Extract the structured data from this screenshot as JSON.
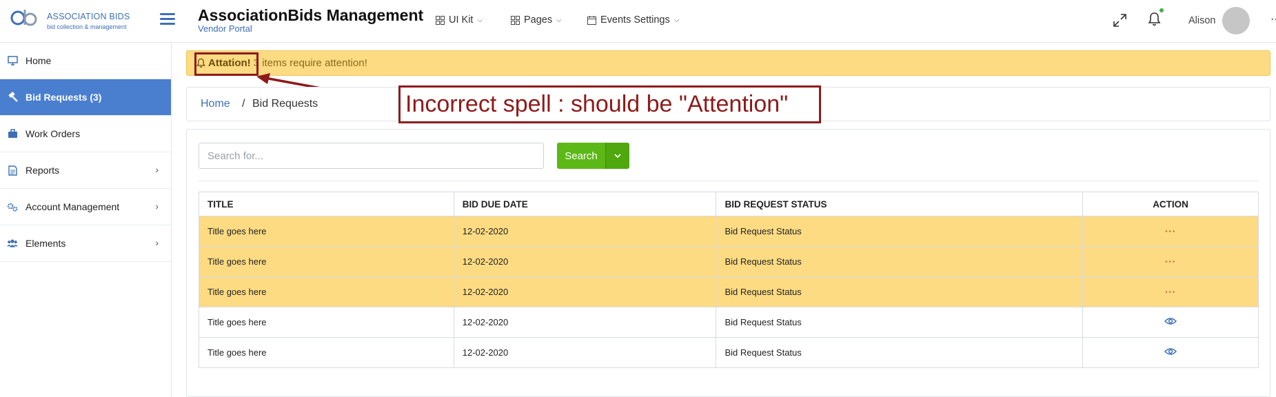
{
  "header": {
    "logo": {
      "name": "ASSOCIATION BIDS",
      "tagline": "bid collection & management"
    },
    "app_title": "AssociationBids Management",
    "app_subtitle": "Vendor Portal",
    "nav": [
      {
        "label": "UI Kit",
        "icon": "grid-icon"
      },
      {
        "label": "Pages",
        "icon": "grid-icon"
      },
      {
        "label": "Events Settings",
        "icon": "calendar-icon"
      }
    ],
    "username": "Alison"
  },
  "sidebar": {
    "items": [
      {
        "label": "Home",
        "icon": "monitor-icon",
        "active": false,
        "has_children": false
      },
      {
        "label": "Bid Requests (3)",
        "icon": "gavel-icon",
        "active": true,
        "has_children": false
      },
      {
        "label": "Work Orders",
        "icon": "briefcase-icon",
        "active": false,
        "has_children": false
      },
      {
        "label": "Reports",
        "icon": "document-icon",
        "active": false,
        "has_children": true
      },
      {
        "label": "Account Management",
        "icon": "gears-icon",
        "active": false,
        "has_children": true
      },
      {
        "label": "Elements",
        "icon": "users-icon",
        "active": false,
        "has_children": true
      }
    ]
  },
  "alert": {
    "strong": "Attation!",
    "text": "3 items require attention!"
  },
  "breadcrumb": {
    "home": "Home",
    "separator": "/",
    "current": "Bid Requests"
  },
  "annotation": {
    "text": "Incorrect spell : should be \"Attention\""
  },
  "search": {
    "placeholder": "Search for...",
    "button_label": "Search"
  },
  "table": {
    "headers": [
      "TITLE",
      "BID DUE DATE",
      "BID REQUEST STATUS",
      "ACTION"
    ],
    "rows": [
      {
        "title": "Title goes here",
        "due": "12-02-2020",
        "status": "Bid Request Status",
        "action": "···",
        "highlighted": true
      },
      {
        "title": "Title goes here",
        "due": "12-02-2020",
        "status": "Bid Request Status",
        "action": "···",
        "highlighted": true
      },
      {
        "title": "Title goes here",
        "due": "12-02-2020",
        "status": "Bid Request Status",
        "action": "···",
        "highlighted": true
      },
      {
        "title": "Title goes here",
        "due": "12-02-2020",
        "status": "Bid Request Status",
        "action": "eye-icon",
        "highlighted": false
      },
      {
        "title": "Title goes here",
        "due": "12-02-2020",
        "status": "Bid Request Status",
        "action": "eye-icon",
        "highlighted": false
      }
    ]
  },
  "colors": {
    "brand_blue": "#3d6fb6",
    "sidebar_active": "#4a7fd0",
    "alert_bg": "#fcdb83",
    "search_green": "#5cb816",
    "annotation_red": "#8e1a1a"
  }
}
